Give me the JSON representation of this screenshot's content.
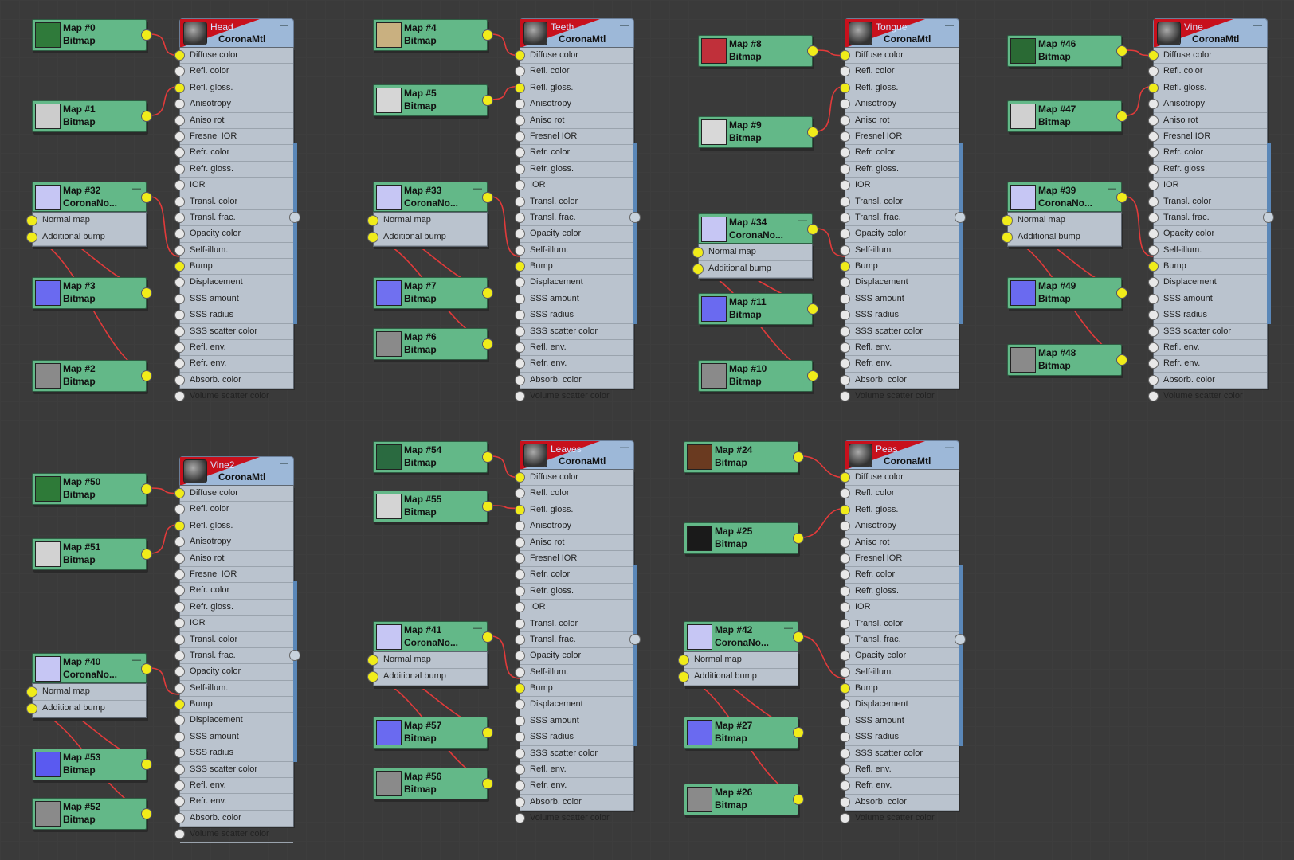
{
  "slot_labels": [
    "Diffuse color",
    "Refl. color",
    "Refl. gloss.",
    "Anisotropy",
    "Aniso rot",
    "Fresnel IOR",
    "Refr. color",
    "Refr. gloss.",
    "IOR",
    "Transl. color",
    "Transl. frac.",
    "Opacity color",
    "Self-illum.",
    "Bump",
    "Displacement",
    "SSS amount",
    "SSS radius",
    "SSS scatter color",
    "Refl. env.",
    "Refr. env.",
    "Absorb. color",
    "Volume scatter color"
  ],
  "normal_slots": [
    "Normal map",
    "Additional bump"
  ],
  "map_type": "Bitmap",
  "normal_type": "CoronaNo...",
  "material_type": "CoronaMtl",
  "materials": [
    {
      "name": "Head",
      "maps": [
        {
          "title": "Map #0",
          "thumb": "#2f7a3a"
        },
        {
          "title": "Map #1",
          "thumb": "#cccccc"
        }
      ],
      "normal": {
        "title": "Map #32"
      },
      "bump_maps": [
        {
          "title": "Map #3",
          "thumb": "#6a6af0"
        },
        {
          "title": "Map #2",
          "thumb": "#8a8a8a"
        }
      ]
    },
    {
      "name": "Teeth",
      "maps": [
        {
          "title": "Map #4",
          "thumb": "#c9b080"
        },
        {
          "title": "Map #5",
          "thumb": "#d6d6d6"
        }
      ],
      "normal": {
        "title": "Map #33"
      },
      "bump_maps": [
        {
          "title": "Map #7",
          "thumb": "#7070f0"
        },
        {
          "title": "Map #6",
          "thumb": "#8a8a8a"
        }
      ]
    },
    {
      "name": "Tongue",
      "maps": [
        {
          "title": "Map #8",
          "thumb": "#c0303a"
        },
        {
          "title": "Map #9",
          "thumb": "#d8d8d8"
        }
      ],
      "normal": {
        "title": "Map #34"
      },
      "bump_maps": [
        {
          "title": "Map #11",
          "thumb": "#6a6af0"
        },
        {
          "title": "Map #10",
          "thumb": "#8a8a8a"
        }
      ]
    },
    {
      "name": "Vine",
      "maps": [
        {
          "title": "Map #46",
          "thumb": "#2a6a34"
        },
        {
          "title": "Map #47",
          "thumb": "#d0d0d0"
        }
      ],
      "normal": {
        "title": "Map #39"
      },
      "bump_maps": [
        {
          "title": "Map #49",
          "thumb": "#6a6af0"
        },
        {
          "title": "Map #48",
          "thumb": "#8a8a8a"
        }
      ]
    },
    {
      "name": "Vine2",
      "maps": [
        {
          "title": "Map #50",
          "thumb": "#2e7a38"
        },
        {
          "title": "Map #51",
          "thumb": "#d2d2d2"
        }
      ],
      "normal": {
        "title": "Map #40"
      },
      "bump_maps": [
        {
          "title": "Map #53",
          "thumb": "#5a5af0"
        },
        {
          "title": "Map #52",
          "thumb": "#8a8a8a"
        }
      ]
    },
    {
      "name": "Leaves",
      "maps": [
        {
          "title": "Map #54",
          "thumb": "#2a6a40"
        },
        {
          "title": "Map #55",
          "thumb": "#d4d4d4"
        }
      ],
      "normal": {
        "title": "Map #41"
      },
      "bump_maps": [
        {
          "title": "Map #57",
          "thumb": "#6a6af0"
        },
        {
          "title": "Map #56",
          "thumb": "#8a8a8a"
        }
      ]
    },
    {
      "name": "Peas",
      "maps": [
        {
          "title": "Map #24",
          "thumb": "#6a3a20"
        },
        {
          "title": "Map #25",
          "thumb": "#1a1a1a"
        }
      ],
      "normal": {
        "title": "Map #42"
      },
      "bump_maps": [
        {
          "title": "Map #27",
          "thumb": "#6a6af0"
        },
        {
          "title": "Map #26",
          "thumb": "#8a8a8a"
        }
      ]
    }
  ],
  "colors": {
    "wire": "#e23a3a",
    "node_green": "#63b888",
    "mat_body": "#bac3ce",
    "mat_header": "#9db8d8",
    "socket_on": "#f0ec1a",
    "background": "#3a3a3a"
  }
}
